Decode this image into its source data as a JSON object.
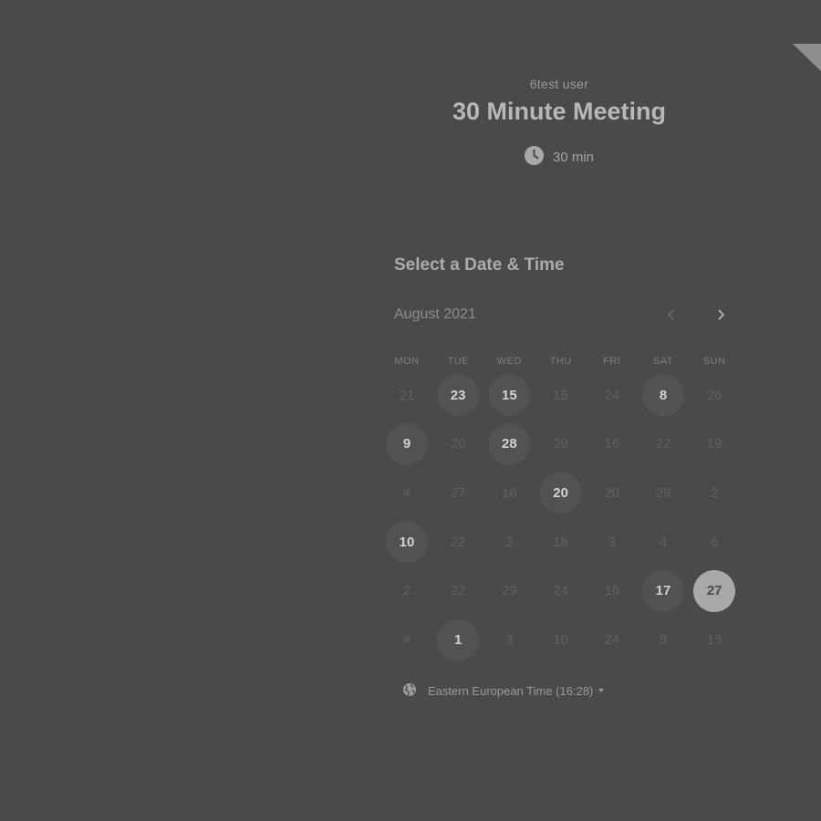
{
  "event": {
    "owner": "6test user",
    "title": "30 Minute Meeting",
    "duration": "30 min"
  },
  "section_title": "Select a Date & Time",
  "calendar": {
    "month_label": "August 2021",
    "weekdays": [
      "MON",
      "TUE",
      "WED",
      "THU",
      "FRI",
      "SAT",
      "SUN"
    ],
    "weeks": [
      [
        {
          "d": "21"
        },
        {
          "d": "23",
          "a": true
        },
        {
          "d": "15",
          "a": true
        },
        {
          "d": "15"
        },
        {
          "d": "24"
        },
        {
          "d": "8",
          "a": true
        },
        {
          "d": "26"
        }
      ],
      [
        {
          "d": "9",
          "a": true
        },
        {
          "d": "20"
        },
        {
          "d": "28",
          "a": true
        },
        {
          "d": "29"
        },
        {
          "d": "16"
        },
        {
          "d": "22"
        },
        {
          "d": "19"
        }
      ],
      [
        {
          "d": "4"
        },
        {
          "d": "27"
        },
        {
          "d": "16"
        },
        {
          "d": "20",
          "a": true
        },
        {
          "d": "20"
        },
        {
          "d": "29"
        },
        {
          "d": "2"
        }
      ],
      [
        {
          "d": "10",
          "a": true
        },
        {
          "d": "22"
        },
        {
          "d": "2"
        },
        {
          "d": "18"
        },
        {
          "d": "3"
        },
        {
          "d": "4"
        },
        {
          "d": "6"
        }
      ],
      [
        {
          "d": "2"
        },
        {
          "d": "22"
        },
        {
          "d": "29"
        },
        {
          "d": "24"
        },
        {
          "d": "16"
        },
        {
          "d": "17",
          "a": true
        },
        {
          "d": "27",
          "s": true
        }
      ],
      [
        {
          "d": "4"
        },
        {
          "d": "1",
          "a": true
        },
        {
          "d": "3"
        },
        {
          "d": "10"
        },
        {
          "d": "24"
        },
        {
          "d": "8"
        },
        {
          "d": "13"
        }
      ]
    ]
  },
  "timezone": {
    "label": "Eastern European Time (16:28)",
    "icon": "globe-icon"
  },
  "icons": {
    "duration": "clock-icon",
    "prev": "chevron-left-icon",
    "next": "chevron-right-icon"
  }
}
